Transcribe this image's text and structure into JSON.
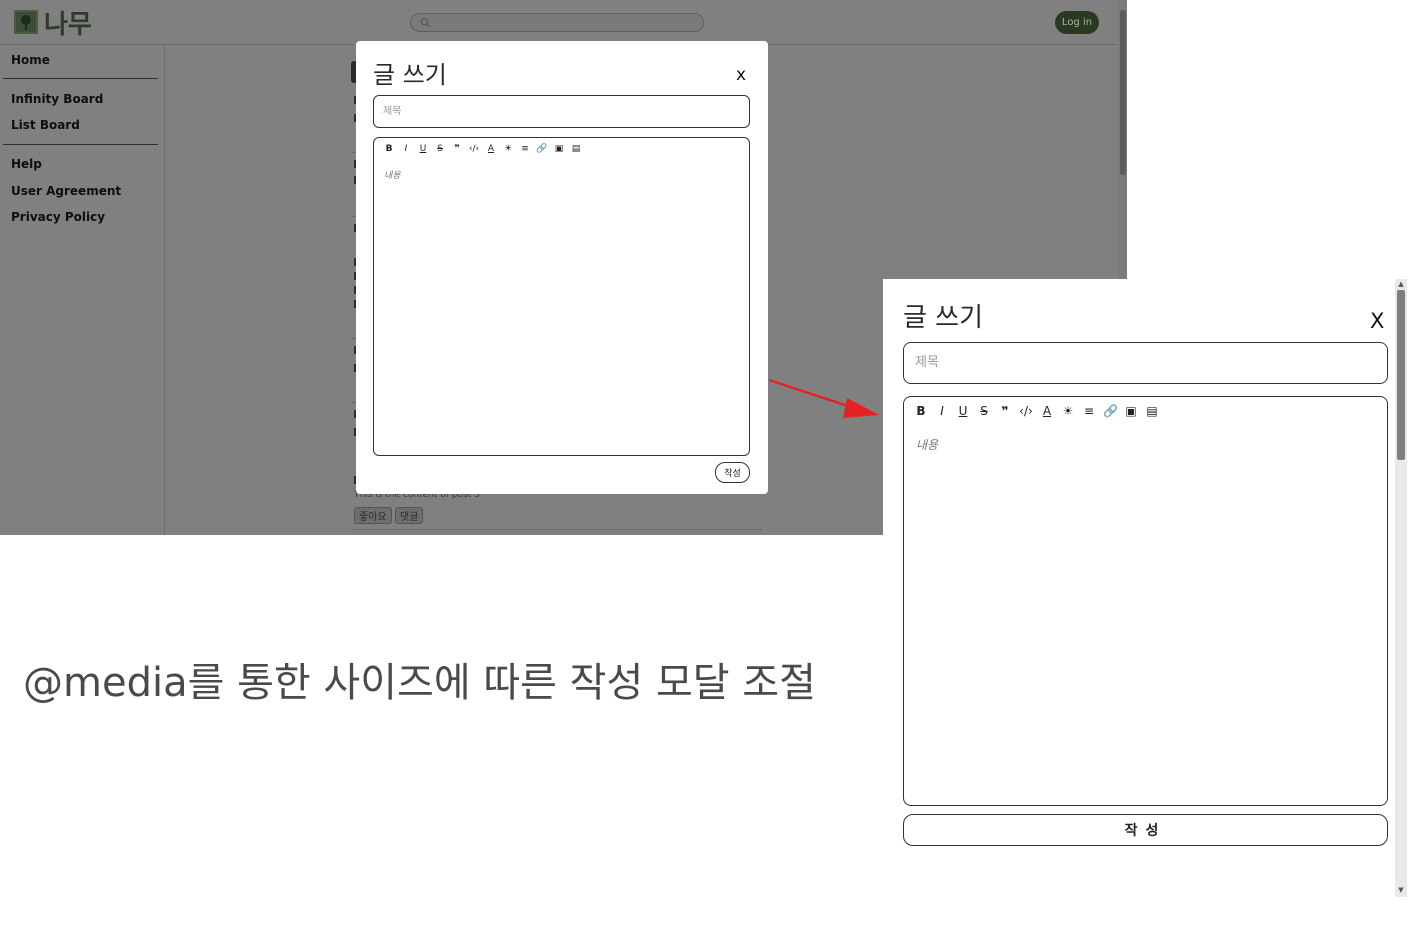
{
  "desktop": {
    "logo_text": "나무",
    "login_label": "Log in",
    "sidebar": {
      "home": "Home",
      "infinity_board": "Infinity Board",
      "list_board": "List Board",
      "help": "Help",
      "user_agreement": "User Agreement",
      "privacy_policy": "Privacy Policy"
    },
    "post3_text": "This is the content of post 3",
    "like_label": "좋아요",
    "comment_label": "댓글"
  },
  "modal": {
    "title": "글 쓰기",
    "close_label": "x",
    "title_placeholder": "제목",
    "content_placeholder": "내용",
    "submit_small": "작성",
    "submit_large": "작성",
    "close_label_large": "X"
  },
  "toolbar_icons": [
    "bold-icon",
    "italic-icon",
    "underline-icon",
    "strikethrough-icon",
    "quote-icon",
    "code-icon",
    "font-color-icon",
    "highlight-icon",
    "align-icon",
    "link-icon",
    "image-icon",
    "video-icon"
  ],
  "caption": "@media를 통한 사이즈에 따른 작성 모달 조절"
}
